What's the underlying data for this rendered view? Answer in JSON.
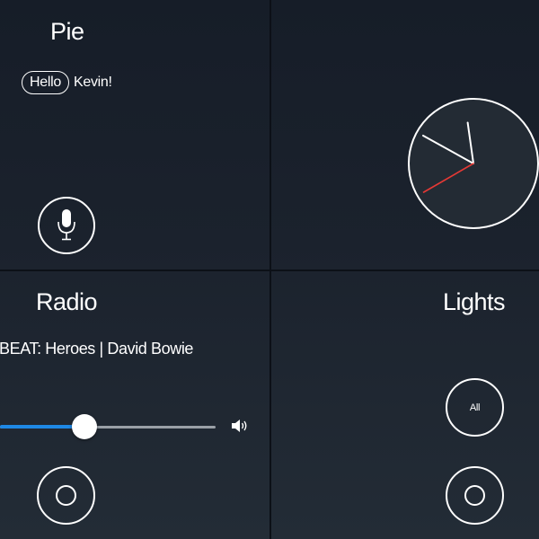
{
  "pie": {
    "title": "Pie",
    "greeting_word": "Hello",
    "greeting_name": "Kevin!",
    "mic_icon": "microphone-icon"
  },
  "clock": {
    "time": {
      "hour": 9,
      "minute": 58,
      "second": 40
    },
    "second_hand_color": "#e53935",
    "face_color": "#232b34"
  },
  "radio": {
    "title": "Radio",
    "track_info": "BEAT: Heroes | David Bowie",
    "volume_level": 0.39,
    "volume_icon": "speaker-volume-icon",
    "accent_color": "#1e88e5"
  },
  "lights": {
    "title": "Lights",
    "all_label": "All"
  }
}
